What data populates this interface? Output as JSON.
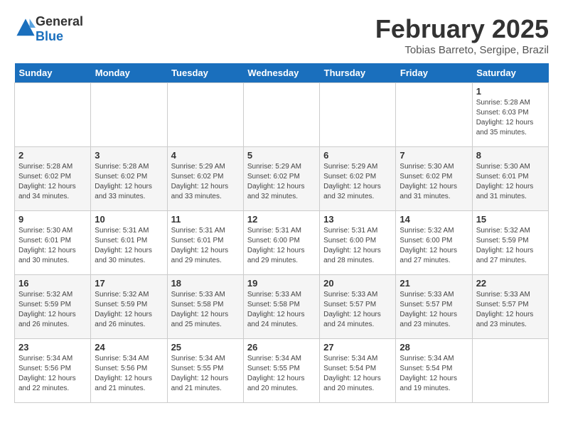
{
  "header": {
    "logo_text_general": "General",
    "logo_text_blue": "Blue",
    "month_year": "February 2025",
    "location": "Tobias Barreto, Sergipe, Brazil"
  },
  "weekdays": [
    "Sunday",
    "Monday",
    "Tuesday",
    "Wednesday",
    "Thursday",
    "Friday",
    "Saturday"
  ],
  "weeks": [
    [
      {
        "day": "",
        "info": ""
      },
      {
        "day": "",
        "info": ""
      },
      {
        "day": "",
        "info": ""
      },
      {
        "day": "",
        "info": ""
      },
      {
        "day": "",
        "info": ""
      },
      {
        "day": "",
        "info": ""
      },
      {
        "day": "1",
        "info": "Sunrise: 5:28 AM\nSunset: 6:03 PM\nDaylight: 12 hours\nand 35 minutes."
      }
    ],
    [
      {
        "day": "2",
        "info": "Sunrise: 5:28 AM\nSunset: 6:02 PM\nDaylight: 12 hours\nand 34 minutes."
      },
      {
        "day": "3",
        "info": "Sunrise: 5:28 AM\nSunset: 6:02 PM\nDaylight: 12 hours\nand 33 minutes."
      },
      {
        "day": "4",
        "info": "Sunrise: 5:29 AM\nSunset: 6:02 PM\nDaylight: 12 hours\nand 33 minutes."
      },
      {
        "day": "5",
        "info": "Sunrise: 5:29 AM\nSunset: 6:02 PM\nDaylight: 12 hours\nand 32 minutes."
      },
      {
        "day": "6",
        "info": "Sunrise: 5:29 AM\nSunset: 6:02 PM\nDaylight: 12 hours\nand 32 minutes."
      },
      {
        "day": "7",
        "info": "Sunrise: 5:30 AM\nSunset: 6:02 PM\nDaylight: 12 hours\nand 31 minutes."
      },
      {
        "day": "8",
        "info": "Sunrise: 5:30 AM\nSunset: 6:01 PM\nDaylight: 12 hours\nand 31 minutes."
      }
    ],
    [
      {
        "day": "9",
        "info": "Sunrise: 5:30 AM\nSunset: 6:01 PM\nDaylight: 12 hours\nand 30 minutes."
      },
      {
        "day": "10",
        "info": "Sunrise: 5:31 AM\nSunset: 6:01 PM\nDaylight: 12 hours\nand 30 minutes."
      },
      {
        "day": "11",
        "info": "Sunrise: 5:31 AM\nSunset: 6:01 PM\nDaylight: 12 hours\nand 29 minutes."
      },
      {
        "day": "12",
        "info": "Sunrise: 5:31 AM\nSunset: 6:00 PM\nDaylight: 12 hours\nand 29 minutes."
      },
      {
        "day": "13",
        "info": "Sunrise: 5:31 AM\nSunset: 6:00 PM\nDaylight: 12 hours\nand 28 minutes."
      },
      {
        "day": "14",
        "info": "Sunrise: 5:32 AM\nSunset: 6:00 PM\nDaylight: 12 hours\nand 27 minutes."
      },
      {
        "day": "15",
        "info": "Sunrise: 5:32 AM\nSunset: 5:59 PM\nDaylight: 12 hours\nand 27 minutes."
      }
    ],
    [
      {
        "day": "16",
        "info": "Sunrise: 5:32 AM\nSunset: 5:59 PM\nDaylight: 12 hours\nand 26 minutes."
      },
      {
        "day": "17",
        "info": "Sunrise: 5:32 AM\nSunset: 5:59 PM\nDaylight: 12 hours\nand 26 minutes."
      },
      {
        "day": "18",
        "info": "Sunrise: 5:33 AM\nSunset: 5:58 PM\nDaylight: 12 hours\nand 25 minutes."
      },
      {
        "day": "19",
        "info": "Sunrise: 5:33 AM\nSunset: 5:58 PM\nDaylight: 12 hours\nand 24 minutes."
      },
      {
        "day": "20",
        "info": "Sunrise: 5:33 AM\nSunset: 5:57 PM\nDaylight: 12 hours\nand 24 minutes."
      },
      {
        "day": "21",
        "info": "Sunrise: 5:33 AM\nSunset: 5:57 PM\nDaylight: 12 hours\nand 23 minutes."
      },
      {
        "day": "22",
        "info": "Sunrise: 5:33 AM\nSunset: 5:57 PM\nDaylight: 12 hours\nand 23 minutes."
      }
    ],
    [
      {
        "day": "23",
        "info": "Sunrise: 5:34 AM\nSunset: 5:56 PM\nDaylight: 12 hours\nand 22 minutes."
      },
      {
        "day": "24",
        "info": "Sunrise: 5:34 AM\nSunset: 5:56 PM\nDaylight: 12 hours\nand 21 minutes."
      },
      {
        "day": "25",
        "info": "Sunrise: 5:34 AM\nSunset: 5:55 PM\nDaylight: 12 hours\nand 21 minutes."
      },
      {
        "day": "26",
        "info": "Sunrise: 5:34 AM\nSunset: 5:55 PM\nDaylight: 12 hours\nand 20 minutes."
      },
      {
        "day": "27",
        "info": "Sunrise: 5:34 AM\nSunset: 5:54 PM\nDaylight: 12 hours\nand 20 minutes."
      },
      {
        "day": "28",
        "info": "Sunrise: 5:34 AM\nSunset: 5:54 PM\nDaylight: 12 hours\nand 19 minutes."
      },
      {
        "day": "",
        "info": ""
      }
    ]
  ]
}
